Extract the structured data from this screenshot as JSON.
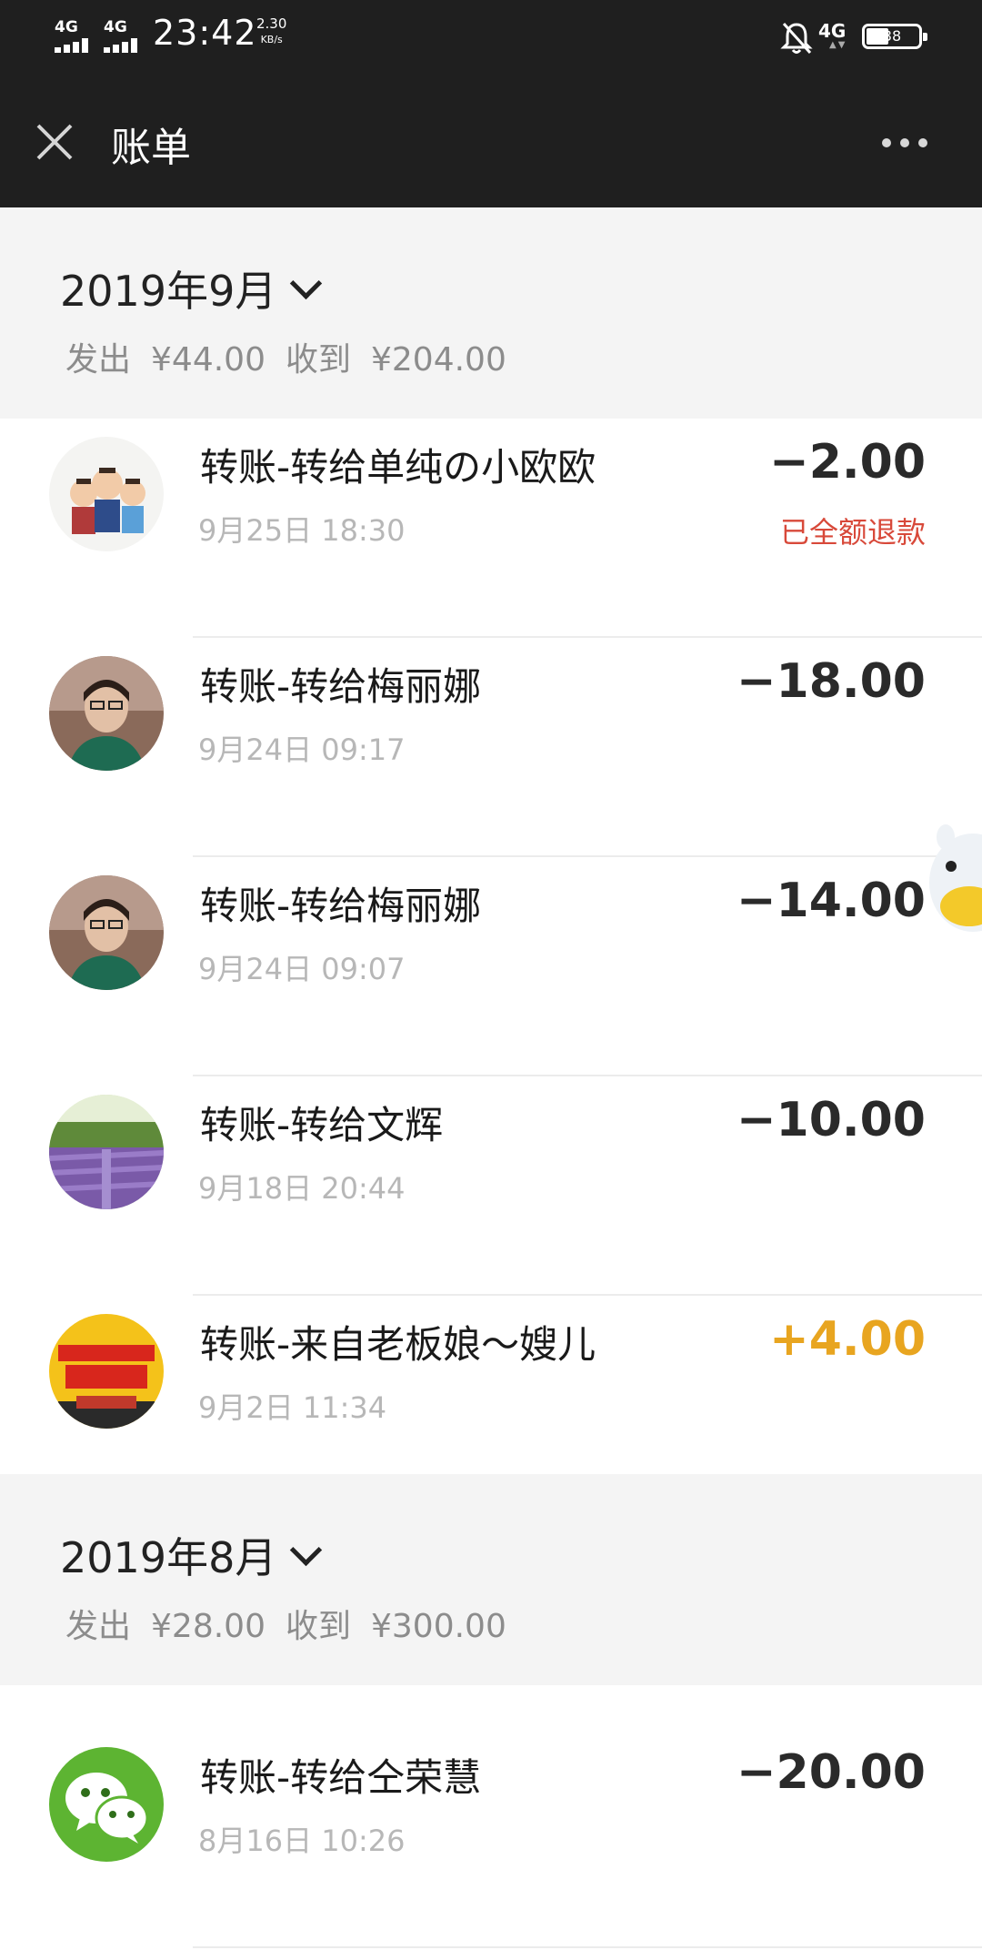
{
  "status_bar": {
    "signal1": "4G",
    "signal2": "4G",
    "time": "23:42",
    "speed_value": "2.30",
    "speed_unit": "KB/s",
    "network": "4G",
    "battery": "38"
  },
  "header": {
    "title": "账单"
  },
  "months": [
    {
      "title": "2019年9月",
      "stats": {
        "sent_label": "发出",
        "sent": "¥44.00",
        "received_label": "收到",
        "received": "¥204.00"
      },
      "items": [
        {
          "name": "转账-转给单纯の小欧欧",
          "time": "9月25日 18:30",
          "amount": "−2.00",
          "status": "已全额退款",
          "avatar": "cartoon-family-avatar"
        },
        {
          "name": "转账-转给梅丽娜",
          "time": "9月24日 09:17",
          "amount": "−18.00",
          "avatar": "woman-portrait-avatar"
        },
        {
          "name": "转账-转给梅丽娜",
          "time": "9月24日 09:07",
          "amount": "−14.00",
          "avatar": "woman-portrait-avatar"
        },
        {
          "name": "转账-转给文辉",
          "time": "9月18日 20:44",
          "amount": "−10.00",
          "avatar": "lavender-field-avatar"
        },
        {
          "name": "转账-来自老板娘～嫂儿",
          "time": "9月2日 11:34",
          "amount": "+4.00",
          "avatar": "group-buy-poster-avatar"
        }
      ]
    },
    {
      "title": "2019年8月",
      "stats": {
        "sent_label": "发出",
        "sent": "¥28.00",
        "received_label": "收到",
        "received": "¥300.00"
      },
      "items": [
        {
          "name": "转账-转给仝荣慧",
          "time": "8月16日 10:26",
          "amount": "−20.00",
          "avatar": "wechat-logo-avatar"
        }
      ]
    }
  ],
  "colors": {
    "bar_bg": "#1f1f1f",
    "section_bg": "#f4f4f4",
    "income": "#e8a520",
    "refund": "#d8493a",
    "muted": "#b7b7b7"
  }
}
